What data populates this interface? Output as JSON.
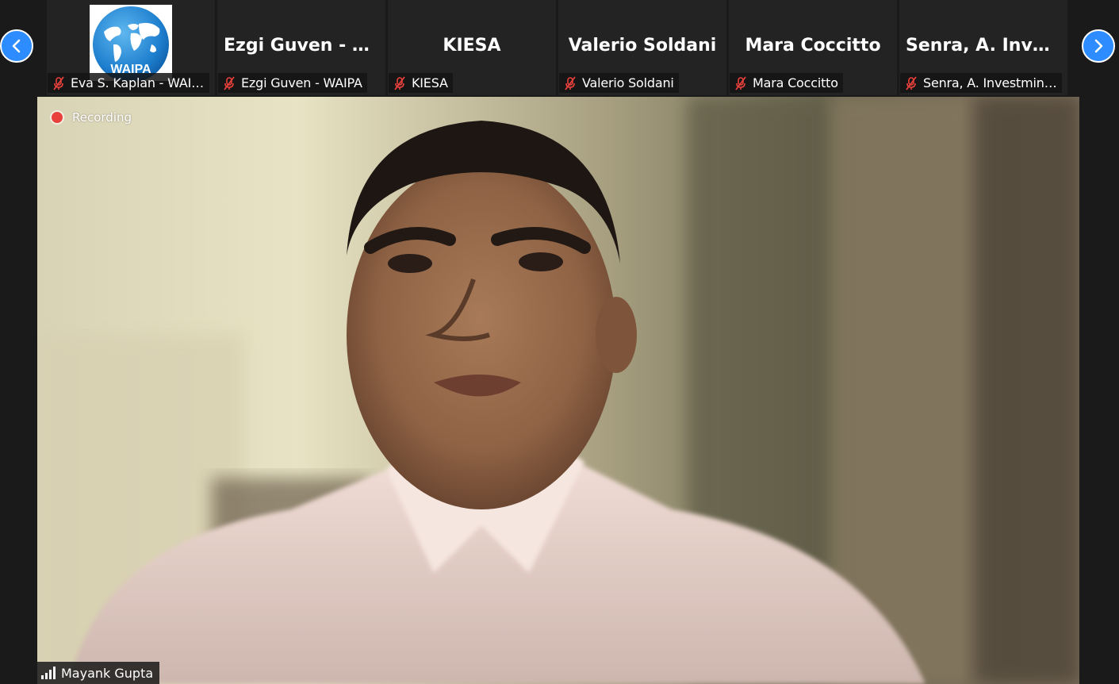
{
  "strip": {
    "prev_icon": "chevron-left-icon",
    "next_icon": "chevron-right-icon",
    "accent_color": "#2d8cff",
    "tiles": [
      {
        "display": "",
        "logo_text": "WAIPA",
        "name": "Eva S. Kaplan - WAIPA",
        "muted": true
      },
      {
        "display": "Ezgi Guven - W...",
        "name": "Ezgi Guven - WAIPA",
        "muted": true
      },
      {
        "display": "KIESA",
        "name": "KIESA",
        "muted": true
      },
      {
        "display": "Valerio Soldani",
        "name": "Valerio Soldani",
        "muted": true
      },
      {
        "display": "Mara Coccitto",
        "name": "Mara Coccitto",
        "muted": true
      },
      {
        "display": "Senra, A. Invest...",
        "name": "Senra, A. Investminas (...",
        "muted": true
      }
    ]
  },
  "main": {
    "recording_label": "Recording",
    "recording_color": "#e8413c",
    "speaker_name": "Mayank Gupta",
    "signal_icon": "signal-bars-icon"
  }
}
